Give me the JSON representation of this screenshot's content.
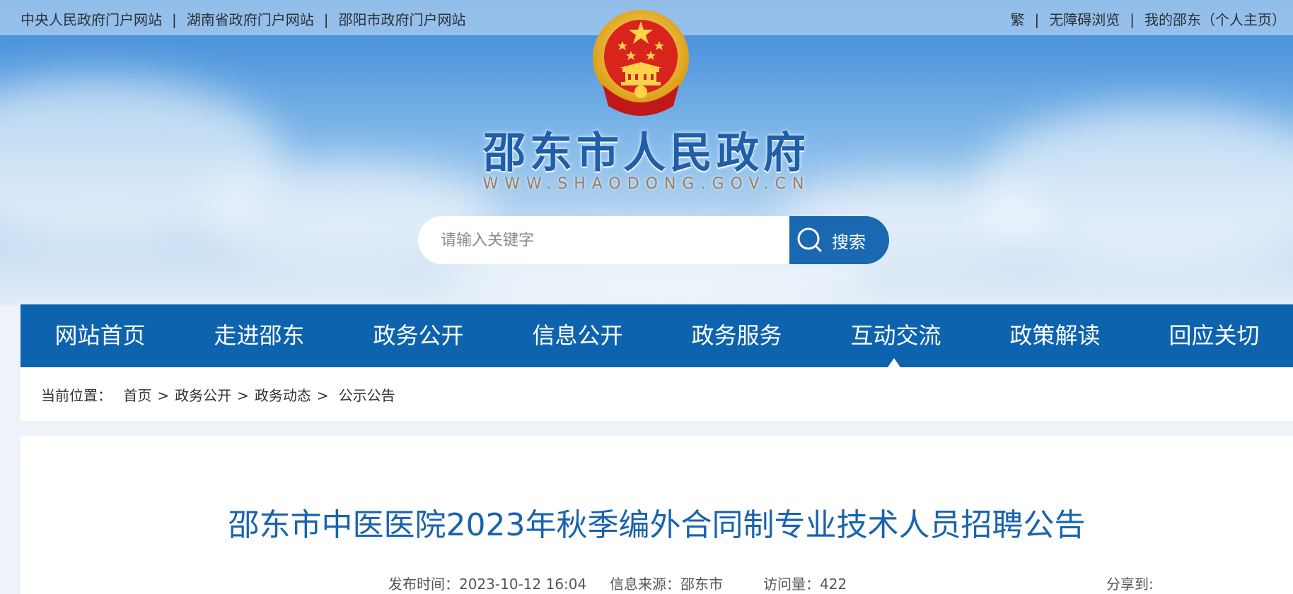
{
  "colors": {
    "nav_bg": "#0d63ae",
    "title": "#1a63ad",
    "site_name": "#1f5ea8",
    "search_btn": "#1a68b0"
  },
  "topbar": {
    "links": [
      "中央人民政府门户网站",
      "湖南省政府门户网站",
      "邵阳市政府门户网站"
    ],
    "right_links": [
      "繁",
      "无障碍浏览",
      "我的邵东（个人主页）"
    ]
  },
  "header": {
    "site_name": "邵东市人民政府",
    "site_url": "WWW.SHAODONG.GOV.CN",
    "emblem_icon": "national-emblem-icon"
  },
  "search": {
    "placeholder": "请输入关键字",
    "button_label": "搜索",
    "icon": "search-icon"
  },
  "nav": {
    "items": [
      "网站首页",
      "走进邵东",
      "政务公开",
      "信息公开",
      "政务服务",
      "互动交流",
      "政策解读",
      "回应关切"
    ],
    "active_index": 5
  },
  "breadcrumb": {
    "prefix": "当前位置：",
    "items": [
      "首页",
      "政务公开",
      "政务动态",
      "公示公告"
    ],
    "separator": ">"
  },
  "article": {
    "title": "邵东市中医医院2023年秋季编外合同制专业技术人员招聘公告",
    "publish_label": "发布时间：",
    "publish_time": "2023-10-12 16:04",
    "source_label": "信息来源：",
    "source": "邵东市",
    "views_label": "访问量：",
    "views": "422",
    "share_label": "分享到:"
  }
}
